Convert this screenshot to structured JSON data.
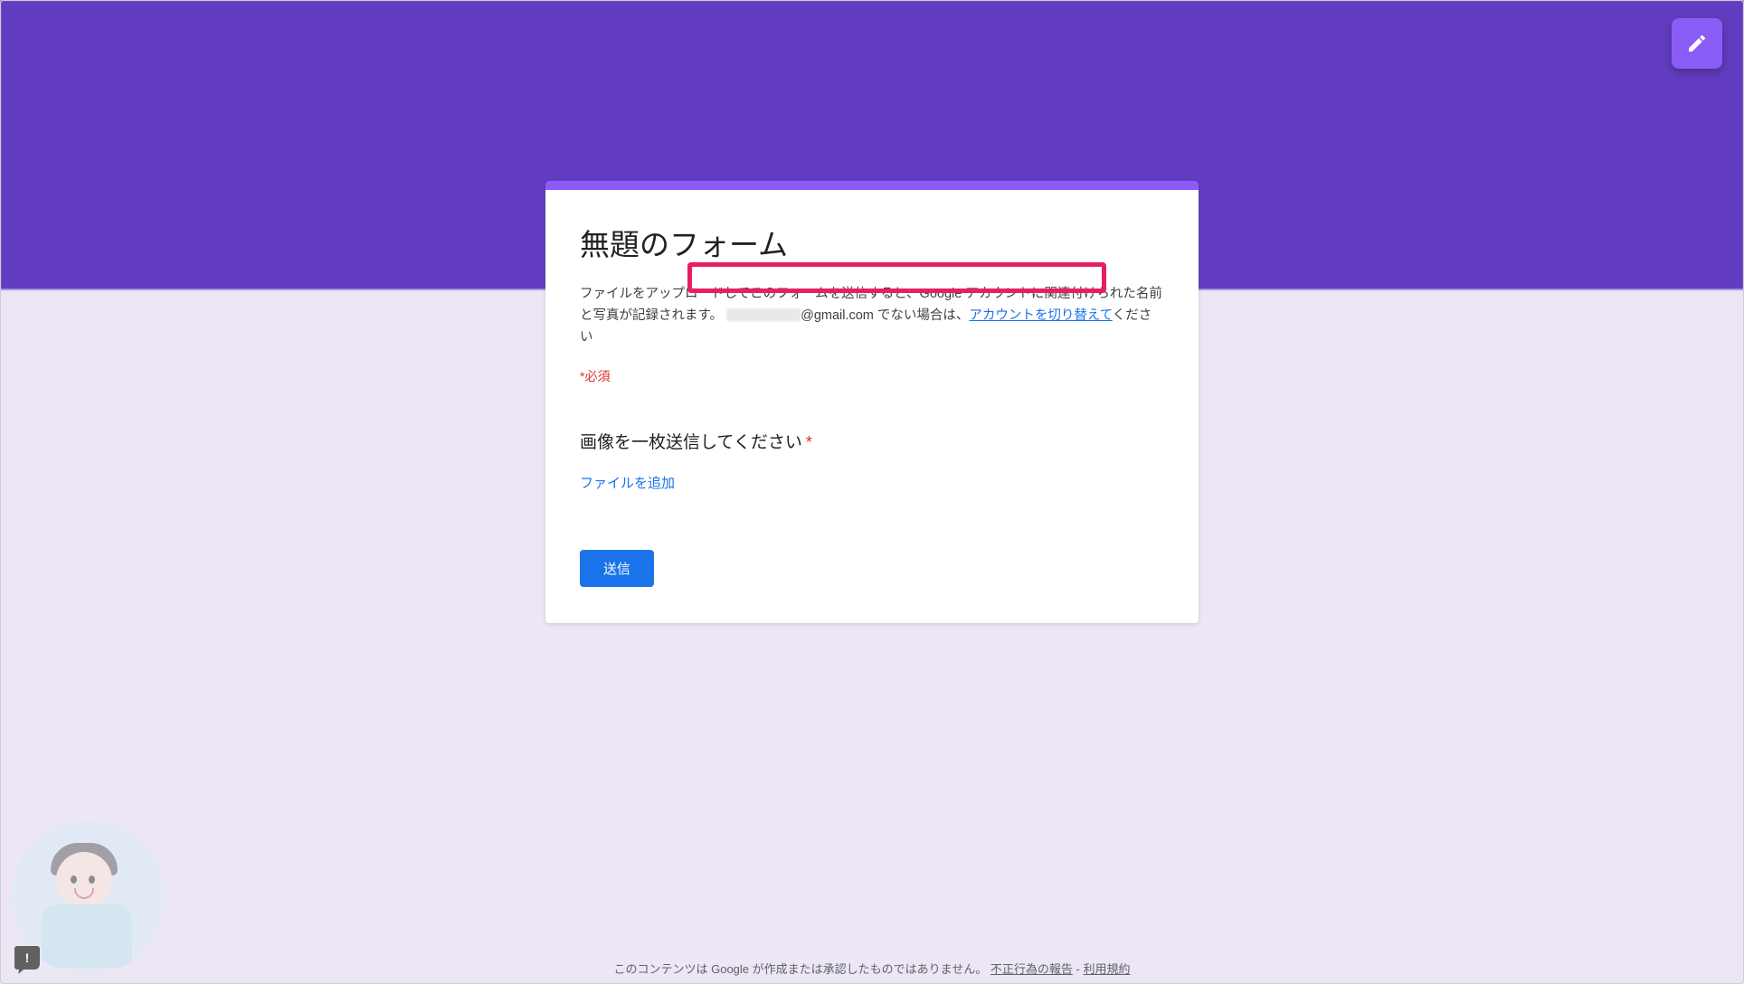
{
  "form": {
    "title": "無題のフォーム",
    "description_prefix": "ファイルをアップロードしてこのフォームを送信すると、Google アカウントに関連付けられた名前と写真が記録されます。",
    "email_domain": "@gmail.com",
    "not_you_text": " でない場合は、",
    "switch_account_link": "アカウントを切り替えて",
    "description_suffix": "ください",
    "required_label": "必須"
  },
  "question": {
    "title": "画像を一枚送信してください",
    "add_file_label": "ファイルを追加"
  },
  "submit_label": "送信",
  "footer": {
    "text_prefix": "このコンテンツは Google が作成または承認したものではありません。",
    "report_abuse": "不正行為の報告",
    "separator": " - ",
    "terms": "利用規約"
  },
  "feedback_glyph": "!"
}
